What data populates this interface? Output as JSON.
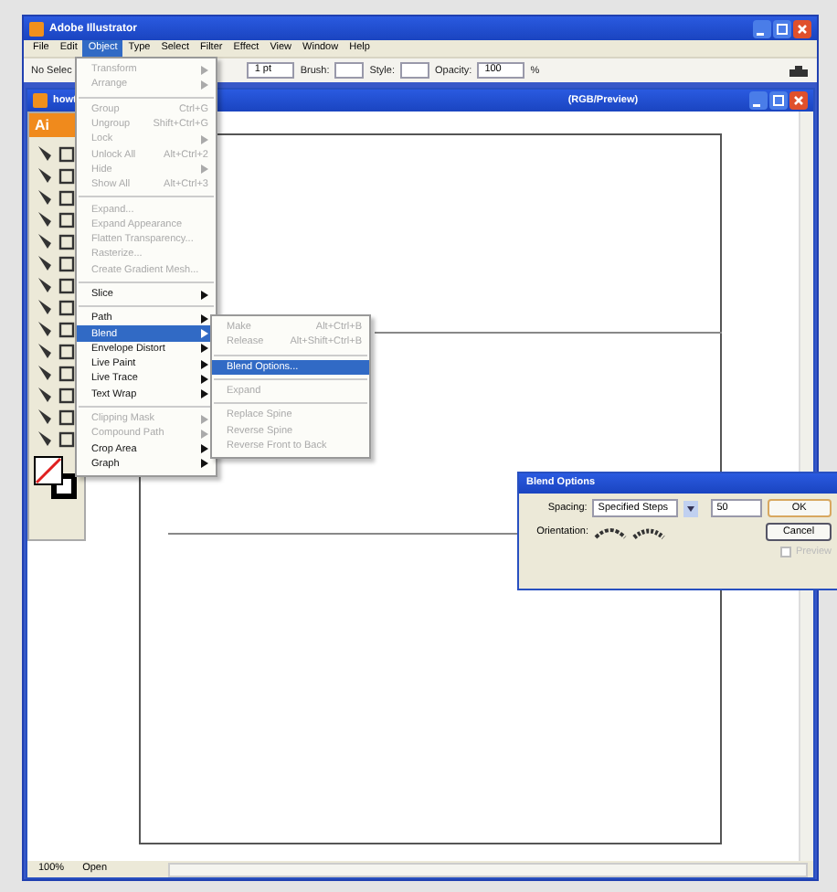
{
  "window": {
    "title": "Adobe Illustrator"
  },
  "menu_bar": [
    {
      "label": "File",
      "selected": false
    },
    {
      "label": "Edit",
      "selected": false
    },
    {
      "label": "Object",
      "selected": true
    },
    {
      "label": "Type",
      "selected": false
    },
    {
      "label": "Select",
      "selected": false
    },
    {
      "label": "Filter",
      "selected": false
    },
    {
      "label": "Effect",
      "selected": false
    },
    {
      "label": "View",
      "selected": false
    },
    {
      "label": "Window",
      "selected": false
    },
    {
      "label": "Help",
      "selected": false
    }
  ],
  "control_bar": {
    "selection": "No Selec",
    "stroke_weight": "1 pt",
    "brush_label": "Brush:",
    "style_label": "Style:",
    "opacity_label": "Opacity:",
    "opacity": "100",
    "opacity_unit": "%"
  },
  "document": {
    "title_start": "howt",
    "title_end": "(RGB/Preview)"
  },
  "toolbox": {
    "logo": "Ai"
  },
  "object_menu": [
    {
      "kind": "item",
      "label": "Transform",
      "submenu": true,
      "disabled": true,
      "selected": false
    },
    {
      "kind": "item",
      "label": "Arrange",
      "submenu": true,
      "disabled": true,
      "selected": false
    },
    {
      "kind": "separator"
    },
    {
      "kind": "item",
      "label": "Group",
      "shortcut": "Ctrl+G",
      "submenu": false,
      "disabled": true,
      "selected": false
    },
    {
      "kind": "item",
      "label": "Ungroup",
      "shortcut": "Shift+Ctrl+G",
      "submenu": false,
      "disabled": true,
      "selected": false
    },
    {
      "kind": "item",
      "label": "Lock",
      "submenu": true,
      "disabled": true,
      "selected": false
    },
    {
      "kind": "item",
      "label": "Unlock All",
      "shortcut": "Alt+Ctrl+2",
      "submenu": false,
      "disabled": true,
      "selected": false
    },
    {
      "kind": "item",
      "label": "Hide",
      "submenu": true,
      "disabled": true,
      "selected": false
    },
    {
      "kind": "item",
      "label": "Show All",
      "shortcut": "Alt+Ctrl+3",
      "submenu": false,
      "disabled": true,
      "selected": false
    },
    {
      "kind": "separator"
    },
    {
      "kind": "item",
      "label": "Expand...",
      "submenu": false,
      "disabled": true,
      "selected": false
    },
    {
      "kind": "item",
      "label": "Expand Appearance",
      "submenu": false,
      "disabled": true,
      "selected": false
    },
    {
      "kind": "item",
      "label": "Flatten Transparency...",
      "submenu": false,
      "disabled": true,
      "selected": false
    },
    {
      "kind": "item",
      "label": "Rasterize...",
      "submenu": false,
      "disabled": true,
      "selected": false
    },
    {
      "kind": "item",
      "label": "Create Gradient Mesh...",
      "submenu": false,
      "disabled": true,
      "selected": false
    },
    {
      "kind": "separator"
    },
    {
      "kind": "item",
      "label": "Slice",
      "submenu": true,
      "disabled": false,
      "selected": false
    },
    {
      "kind": "separator"
    },
    {
      "kind": "item",
      "label": "Path",
      "submenu": true,
      "disabled": false,
      "selected": false
    },
    {
      "kind": "item",
      "label": "Blend",
      "submenu": true,
      "disabled": false,
      "selected": true
    },
    {
      "kind": "item",
      "label": "Envelope Distort",
      "submenu": true,
      "disabled": false,
      "selected": false
    },
    {
      "kind": "item",
      "label": "Live Paint",
      "submenu": true,
      "disabled": false,
      "selected": false
    },
    {
      "kind": "item",
      "label": "Live Trace",
      "submenu": true,
      "disabled": false,
      "selected": false
    },
    {
      "kind": "item",
      "label": "Text Wrap",
      "submenu": true,
      "disabled": false,
      "selected": false
    },
    {
      "kind": "separator"
    },
    {
      "kind": "item",
      "label": "Clipping Mask",
      "submenu": true,
      "disabled": true,
      "selected": false
    },
    {
      "kind": "item",
      "label": "Compound Path",
      "submenu": true,
      "disabled": true,
      "selected": false
    },
    {
      "kind": "item",
      "label": "Crop Area",
      "submenu": true,
      "disabled": false,
      "selected": false
    },
    {
      "kind": "item",
      "label": "Graph",
      "submenu": true,
      "disabled": false,
      "selected": false
    }
  ],
  "blend_submenu": [
    {
      "kind": "item",
      "label": "Make",
      "shortcut": "Alt+Ctrl+B",
      "disabled": true,
      "selected": false
    },
    {
      "kind": "item",
      "label": "Release",
      "shortcut": "Alt+Shift+Ctrl+B",
      "disabled": true,
      "selected": false
    },
    {
      "kind": "separator"
    },
    {
      "kind": "item",
      "label": "Blend Options...",
      "disabled": false,
      "selected": true
    },
    {
      "kind": "separator"
    },
    {
      "kind": "item",
      "label": "Expand",
      "disabled": true,
      "selected": false
    },
    {
      "kind": "separator"
    },
    {
      "kind": "item",
      "label": "Replace Spine",
      "disabled": true,
      "selected": false
    },
    {
      "kind": "item",
      "label": "Reverse Spine",
      "disabled": true,
      "selected": false
    },
    {
      "kind": "item",
      "label": "Reverse Front to Back",
      "disabled": true,
      "selected": false
    }
  ],
  "blend_options": {
    "title": "Blend Options",
    "spacing_label": "Spacing:",
    "spacing": "Specified Steps",
    "steps": "50",
    "orientation_label": "Orientation:",
    "buttons": [
      "OK",
      "Cancel"
    ],
    "preview": {
      "label": "Preview",
      "checked": false,
      "disabled": true
    }
  },
  "status_bar": {
    "zoom": "100%",
    "status": "Open"
  }
}
